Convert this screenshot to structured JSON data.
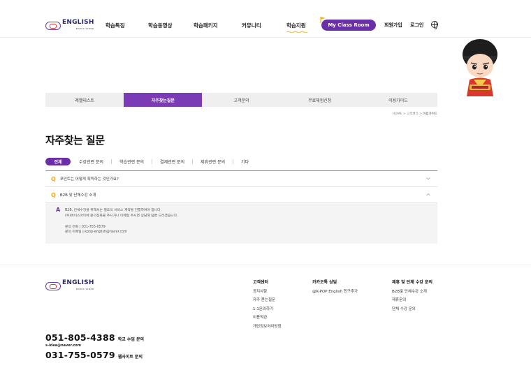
{
  "header": {
    "logo": {
      "text": "ENGLISH",
      "sub": "MUSIC VIDEO"
    },
    "nav": [
      "학습특징",
      "학습동영상",
      "학습패키지",
      "커뮤니티",
      "학습지원"
    ],
    "my_class": "My Class Room",
    "signup": "회원가입",
    "login": "로그인",
    "accent": "#6a2fa7"
  },
  "tabs": [
    "레벨테스트",
    "자주찾는질문",
    "고객문의",
    "무료체험신청",
    "이용가이드"
  ],
  "active_tab": 1,
  "breadcrumb": {
    "home": "HOME",
    "sep": ">",
    "level1": "고객센터",
    "current": "이용가이드"
  },
  "page_title": "자주찾는 질문",
  "filters": [
    "전체",
    "수강관련 문의",
    "학습관련 문의",
    "결제관련 문의",
    "제휴관련 문의",
    "기타"
  ],
  "faq": [
    {
      "q_mark": "Q",
      "question": "포인트는 어떻게 획득하는 것인가요?",
      "expanded": false
    },
    {
      "q_mark": "Q",
      "question": "B2B 및 단체수강 소개",
      "expanded": true
    }
  ],
  "answer": {
    "a_mark": "A",
    "line1": "B2B, 단체수강을 위해서는 별도의 서비스 계약을 진행하여야 합니다.",
    "line2": "(주)에이스아이에 문의전화를 주시거나 이메일 주시면 상담해 답변 드리겠습니다.",
    "line3": "문의 전화 | 031-755-0579",
    "line4": "문의 이메일 | kpop-english@naver.com"
  },
  "footer": {
    "logo": {
      "text": "ENGLISH",
      "sub": "MUSIC VIDEO"
    },
    "col1": {
      "head": "고객센터",
      "items": [
        "공지사항",
        "자주 묻는질문",
        "1:1문의하기",
        "이용약관",
        "개인정보처리방침"
      ]
    },
    "col2": {
      "head": "카카오톡 상담",
      "items": [
        "@K-POP English 친구추가"
      ]
    },
    "col3": {
      "head": "제휴 및 단체 수강 문의",
      "items": [
        "B2B및 단체수강 소개",
        "제휴문의",
        "단체 수강 문의"
      ]
    },
    "phone1": {
      "num": "051-805-4388",
      "label": "학교 수업 문의"
    },
    "email": "s-idea@naver.com",
    "phone2": {
      "num": "031-755-0579",
      "label": "웹사이트 문의"
    }
  }
}
